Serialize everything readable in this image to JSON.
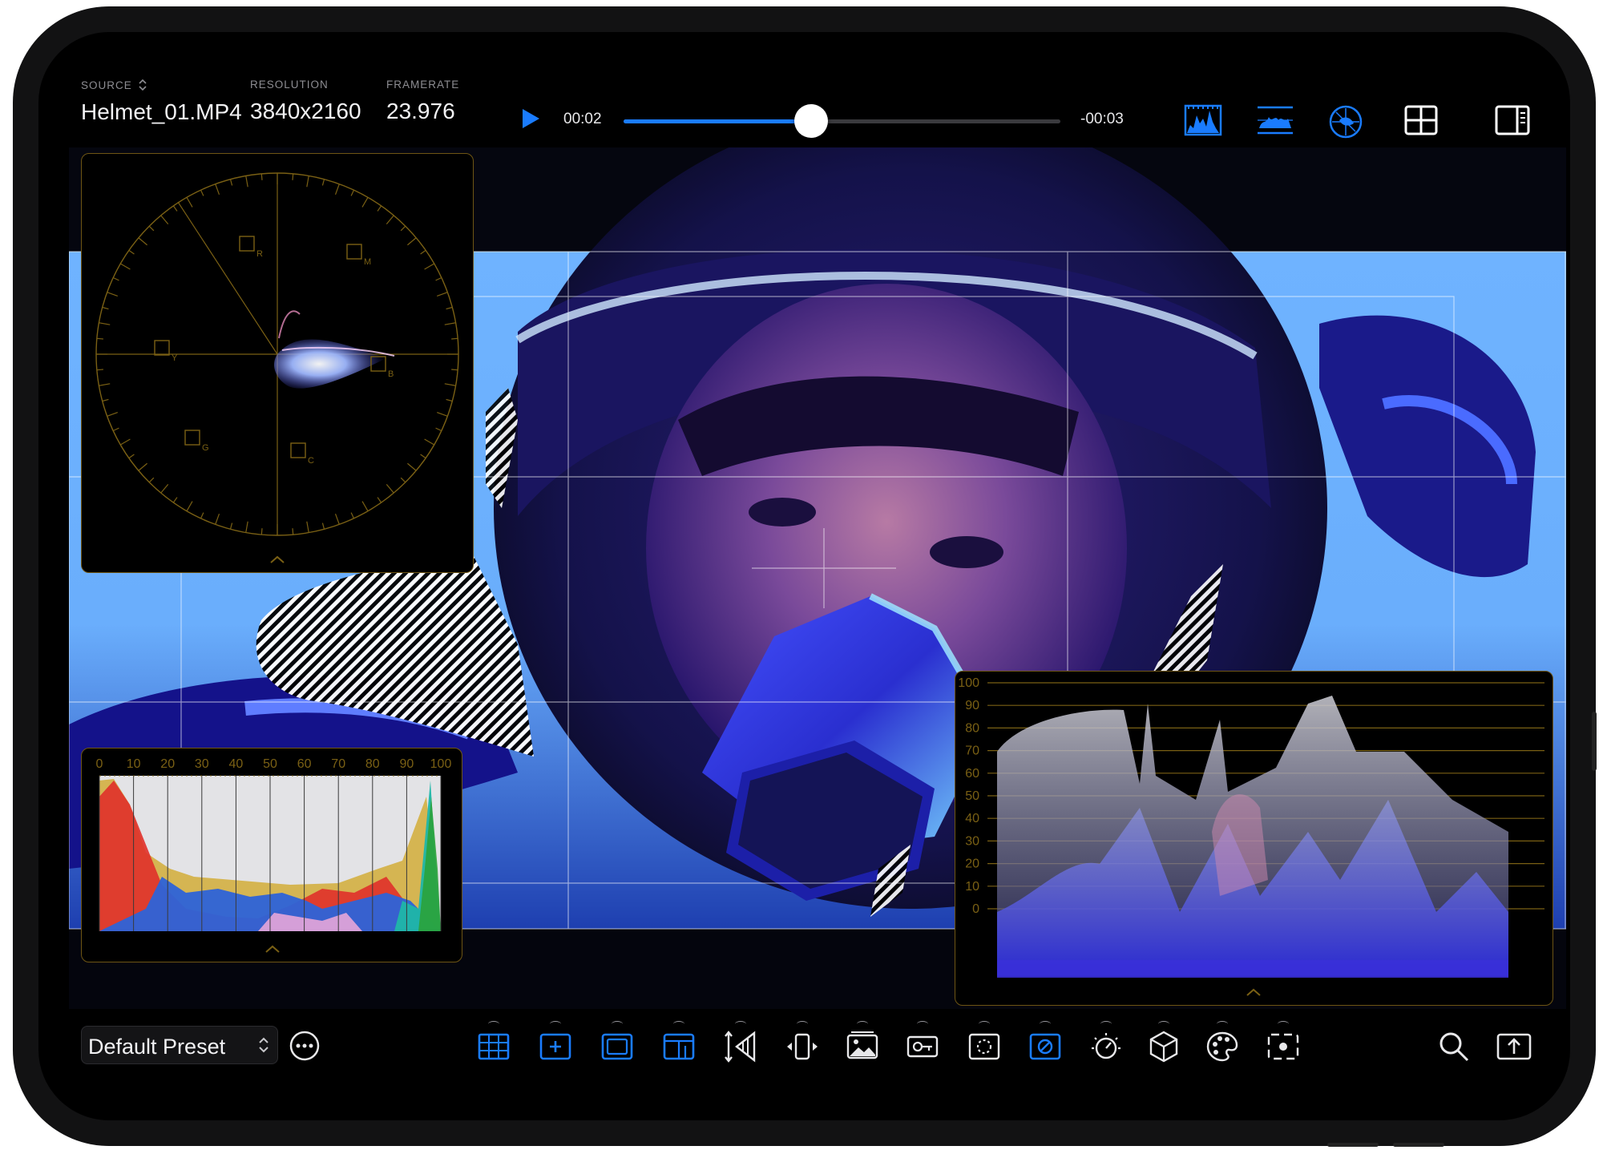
{
  "clip": {
    "source_label": "SOURCE",
    "source_value": "Helmet_01.MP4",
    "resolution_label": "RESOLUTION",
    "resolution_value": "3840x2160",
    "framerate_label": "FRAMERATE",
    "framerate_value": "23.976"
  },
  "playback": {
    "elapsed": "00:02",
    "remaining": "-00:03",
    "progress": 0.43
  },
  "toolbar_icons": [
    "histogram-scope-icon",
    "waveform-scope-icon",
    "vectorscope-icon",
    "grid-layout-icon",
    "sidebar-panel-icon"
  ],
  "vectorscope": {
    "targets": [
      "R",
      "M",
      "B",
      "C",
      "G",
      "Y"
    ]
  },
  "histogram": {
    "axis_ticks": [
      "0",
      "10",
      "20",
      "30",
      "40",
      "50",
      "60",
      "70",
      "80",
      "90",
      "100"
    ]
  },
  "waveform": {
    "axis_ticks": [
      "100",
      "90",
      "80",
      "70",
      "60",
      "50",
      "40",
      "30",
      "20",
      "10",
      "0"
    ]
  },
  "preset": {
    "label": "Default Preset"
  },
  "bottom_tools": [
    "grid-overlay-icon",
    "center-marker-icon",
    "safe-area-icon",
    "frame-guide-icon",
    "anamorphic-icon",
    "flip-icon",
    "image-overlay-icon",
    "false-color-icon",
    "zebra-icon",
    "mask-icon",
    "exposure-icon",
    "lut-cube-icon",
    "color-palette-icon",
    "focus-peaking-icon"
  ],
  "accent_color": "#1a7cff",
  "scope_border_color": "#6e5514"
}
